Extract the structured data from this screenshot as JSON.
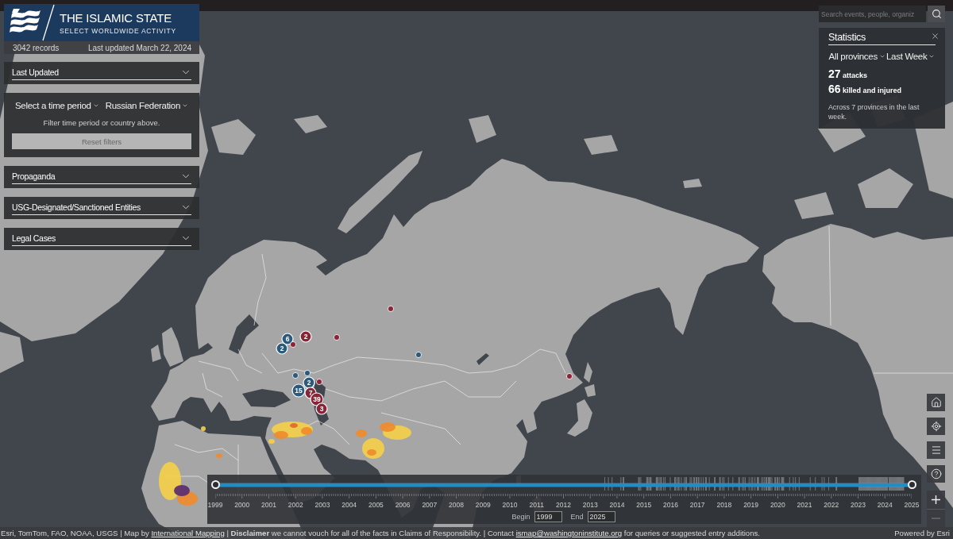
{
  "header": {
    "title": "THE ISLAMIC STATE",
    "subtitle": "SELECT WORLDWIDE ACTIVITY",
    "records": "3042 records",
    "last_updated": "Last updated March 22, 2024"
  },
  "sections": [
    {
      "kind": "accordion",
      "label": "Last Updated",
      "expanded": false
    },
    {
      "kind": "filters",
      "dropdowns": [
        "Select a time period",
        "Russian Federation"
      ],
      "hint": "Filter time period or country above.",
      "reset_button": "Reset filters"
    },
    {
      "kind": "accordion",
      "label": "Propaganda",
      "expanded": false
    },
    {
      "kind": "accordion",
      "label": "USG-Designated/Sanctioned Entities",
      "expanded": false
    },
    {
      "kind": "accordion",
      "label": "Legal Cases",
      "expanded": false
    }
  ],
  "search": {
    "placeholder": "Search events, people, organiz"
  },
  "statistics": {
    "title": "Statistics",
    "filters": [
      "All provinces",
      "Last Week"
    ],
    "stats": [
      {
        "value": "27",
        "label": "attacks"
      },
      {
        "value": "66",
        "label": "killed and injured"
      }
    ],
    "summary": "Across 7 provinces in the last week."
  },
  "map_markers": [
    {
      "color": "#8a2437"
    },
    {
      "label": "2",
      "color": "#8a2437"
    },
    {
      "color": "#8a2437"
    },
    {
      "label": "6",
      "color": "#2c5a7c"
    },
    {
      "color": "#8a2437"
    },
    {
      "label": "2",
      "color": "#2c5a7c"
    },
    {
      "color": "#2c5a7c"
    },
    {
      "color": "#2c5a7c"
    },
    {
      "color": "#2c5a7c"
    },
    {
      "color": "#8a2437"
    },
    {
      "label": "2",
      "color": "#2c5a7c"
    },
    {
      "color": "#8a2437"
    },
    {
      "label": "15",
      "color": "#2c5a7c"
    },
    {
      "label": "7",
      "color": "#8a2437"
    },
    {
      "label": "39",
      "color": "#8a2437"
    },
    {
      "label": "3",
      "color": "#8a2437"
    }
  ],
  "map_controls": {
    "buttons": [
      {
        "kind": "home"
      },
      {
        "kind": "locate"
      },
      {
        "kind": "list"
      },
      {
        "kind": "help"
      }
    ],
    "zoom": [
      {
        "kind": "in",
        "disabled": false
      },
      {
        "kind": "out",
        "disabled": true
      }
    ]
  },
  "timeline": {
    "years": [
      "1999",
      "2000",
      "2001",
      "2002",
      "2003",
      "2004",
      "2005",
      "2006",
      "2007",
      "2008",
      "2009",
      "2010",
      "2011",
      "2012",
      "2013",
      "2014",
      "2015",
      "2016",
      "2017",
      "2018",
      "2019",
      "2020",
      "2021",
      "2022",
      "2023",
      "2024",
      "2025"
    ],
    "thumbs": [
      {
        "level": 0
      },
      {
        "level": 1
      }
    ],
    "begin": {
      "label": "Begin",
      "value": "1999"
    },
    "end": {
      "label": "End",
      "value": "2025"
    }
  },
  "attribution": {
    "sources": "Esri, TomTom, FAO, NOAA, USGS | Map by",
    "map_link": "International Mapping",
    "disclaimer": "| **Disclaimer** we cannot vouch for all of the facts in Claims of Responsibility. | Contact",
    "contact_link": "ismap@washingtoninstitute.org",
    "closing": "for queries or suggested entry additions."
  },
  "powered_by": "Powered by Esri"
}
